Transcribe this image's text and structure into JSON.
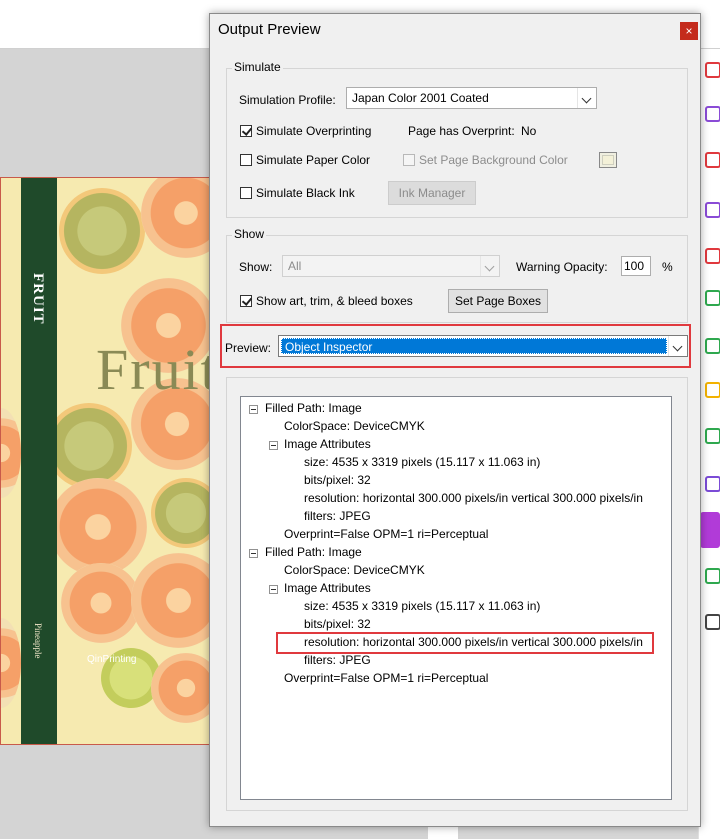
{
  "cover": {
    "spine_title": "FRUIT",
    "spine_subtitle": "Pineapple",
    "title": "Fruit",
    "brand": "QinPrinting"
  },
  "dialog": {
    "title": "Output Preview",
    "close_label": "×",
    "simulate": {
      "group_label": "Simulate",
      "profile_label": "Simulation Profile:",
      "profile_value": "Japan Color 2001 Coated",
      "overprinting_label": "Simulate Overprinting",
      "overprinting_checked": true,
      "page_overprint_label": "Page has Overprint:",
      "page_overprint_value": "No",
      "paper_color_label": "Simulate Paper Color",
      "page_bg_label": "Set Page Background Color",
      "black_ink_label": "Simulate Black Ink",
      "ink_manager_label": "Ink Manager"
    },
    "show": {
      "group_label": "Show",
      "show_label": "Show:",
      "show_value": "All",
      "warning_label": "Warning Opacity:",
      "warning_value": "100",
      "percent": "%",
      "boxes_label": "Show art, trim, & bleed boxes",
      "boxes_checked": true,
      "set_page_boxes_label": "Set Page Boxes"
    },
    "preview": {
      "label": "Preview:",
      "value": "Object Inspector"
    },
    "tree": [
      {
        "text": "Filled Path: Image",
        "level": 0,
        "expander": true
      },
      {
        "text": "ColorSpace: DeviceCMYK",
        "level": 1,
        "expander": false
      },
      {
        "text": "Image Attributes",
        "level": 1,
        "expander": true
      },
      {
        "text": "size: 4535 x 3319 pixels (15.117 x 11.063 in)",
        "level": 2,
        "expander": false
      },
      {
        "text": "bits/pixel: 32",
        "level": 2,
        "expander": false
      },
      {
        "text": "resolution: horizontal 300.000 pixels/in vertical 300.000 pixels/in",
        "level": 2,
        "expander": false
      },
      {
        "text": "filters: JPEG",
        "level": 2,
        "expander": false
      },
      {
        "text": "Overprint=False OPM=1 ri=Perceptual",
        "level": 1,
        "expander": false
      },
      {
        "text": "Filled Path: Image",
        "level": 0,
        "expander": true
      },
      {
        "text": "ColorSpace: DeviceCMYK",
        "level": 1,
        "expander": false
      },
      {
        "text": "Image Attributes",
        "level": 1,
        "expander": true
      },
      {
        "text": "size: 4535 x 3319 pixels (15.117 x 11.063 in)",
        "level": 2,
        "expander": false
      },
      {
        "text": "bits/pixel: 32",
        "level": 2,
        "expander": false
      },
      {
        "text": "resolution: horizontal 300.000 pixels/in vertical 300.000 pixels/in",
        "level": 2,
        "expander": false,
        "highlighted": true
      },
      {
        "text": "filters: JPEG",
        "level": 2,
        "expander": false
      },
      {
        "text": "Overprint=False OPM=1 ri=Perceptual",
        "level": 1,
        "expander": false
      }
    ],
    "highlight_color": "#e0393e"
  },
  "toolbar_icons": [
    {
      "name": "export-pdf-icon",
      "color": "#e0393e"
    },
    {
      "name": "combine-files-icon",
      "color": "#8a4bd6"
    },
    {
      "name": "organize-pages-icon",
      "color": "#e0393e"
    },
    {
      "name": "edit-pdf-icon",
      "color": "#8a4bd6"
    },
    {
      "name": "create-pdf-icon",
      "color": "#e0393e"
    },
    {
      "name": "scan-icon",
      "color": "#2fa84f"
    },
    {
      "name": "compress-icon",
      "color": "#2fa84f"
    },
    {
      "name": "comment-icon",
      "color": "#f3b200"
    },
    {
      "name": "print-production-icon",
      "color": "#2fa84f"
    },
    {
      "name": "protect-icon",
      "color": "#7b4bd6"
    },
    {
      "name": "active-tool-icon",
      "color": "#b13bd8"
    },
    {
      "name": "compare-icon",
      "color": "#2fa84f"
    },
    {
      "name": "more-tools-icon",
      "color": "#444444"
    }
  ]
}
